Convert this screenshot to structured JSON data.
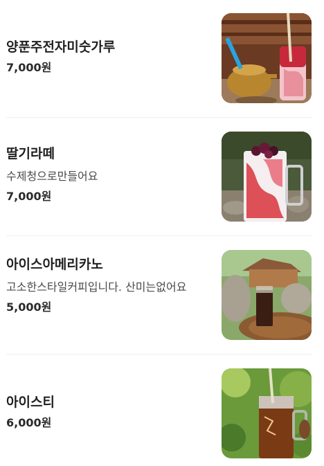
{
  "menu": {
    "items": [
      {
        "name": "양푼주전자미숫가루",
        "description": "",
        "price": "7,000원",
        "photo": "iced-misutgaru-with-kettle-photo"
      },
      {
        "name": "딸기라떼",
        "description": "수제청으로만들어요",
        "price": "7,000원",
        "photo": "strawberry-latte-photo"
      },
      {
        "name": "아이스아메리카노",
        "description": "고소한스타일커피입니다. 산미는없어요",
        "price": "5,000원",
        "photo": "iced-americano-photo"
      },
      {
        "name": "아이스티",
        "description": "",
        "price": "6,000원",
        "photo": "iced-tea-photo"
      }
    ]
  }
}
